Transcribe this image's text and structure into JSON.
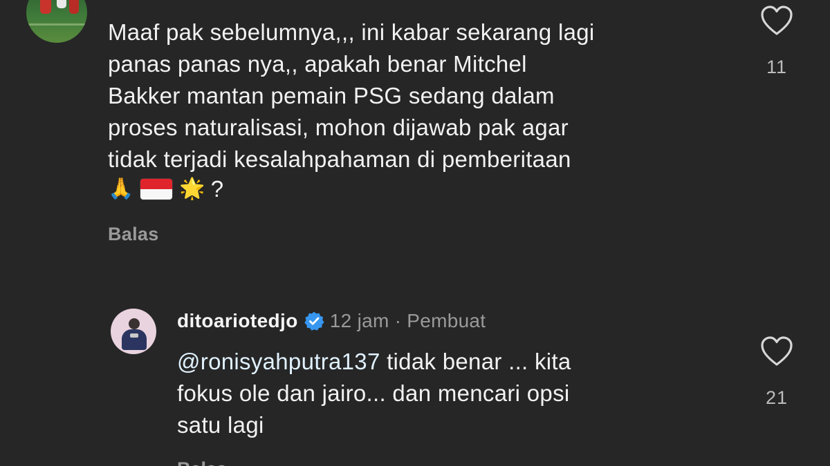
{
  "top_comment": {
    "username": "",
    "text_lines": [
      "Maaf pak sebelumnya,,, ini kabar sekarang lagi",
      "panas panas nya,, apakah benar Mitchel",
      "Bakker mantan pemain PSG sedang dalam",
      "proses naturalisasi, mohon dijawab pak agar",
      "tidak terjadi kesalahpahaman di pemberitaan"
    ],
    "emojis": {
      "pray": "🙏",
      "flag": "🇮🇩",
      "star": "🌟"
    },
    "trailing_text": "?",
    "reply_label": "Balas",
    "like_count": "11",
    "avatar_icon": "soccer-players-avatar"
  },
  "reply_comment": {
    "username": "ditoariotedjo",
    "verified_icon": "verified-badge-icon",
    "time": "12 jam",
    "separator": "·",
    "role": "Pembuat",
    "mention": "@ronisyahputra137",
    "text_line1_rest": " tidak benar ... kita",
    "text_lines_more": [
      "fokus ole dan jairo... dan mencari opsi",
      "satu lagi"
    ],
    "reply_label": "Balas",
    "like_count": "21",
    "avatar_icon": "user-avatar"
  },
  "colors": {
    "background": "#262626",
    "primary_text": "#f2f2f2",
    "secondary_text": "#9a9a9a",
    "verified_blue": "#3797f0"
  }
}
